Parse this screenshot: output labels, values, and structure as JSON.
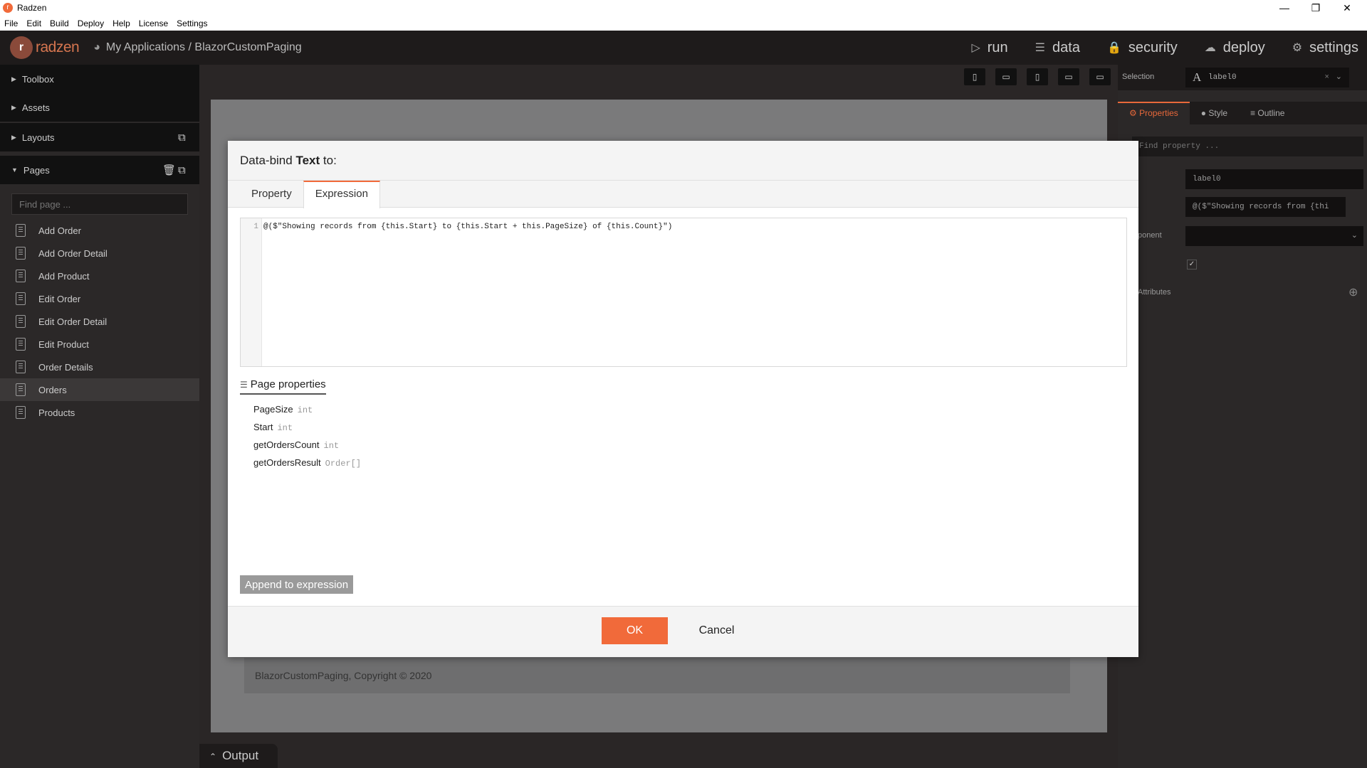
{
  "window": {
    "title": "Radzen",
    "icon": "radzen-app-icon",
    "controls": [
      "minimize",
      "maximize",
      "close"
    ]
  },
  "menu": [
    "File",
    "Edit",
    "Build",
    "Deploy",
    "Help",
    "License",
    "Settings"
  ],
  "header": {
    "logo_text": "radzen",
    "breadcrumb": "My Applications / BlazorCustomPaging",
    "nav": [
      {
        "label": "run",
        "icon": "play-icon"
      },
      {
        "label": "data",
        "icon": "layers-icon"
      },
      {
        "label": "security",
        "icon": "lock-icon"
      },
      {
        "label": "deploy",
        "icon": "cloud-upload-icon"
      },
      {
        "label": "settings",
        "icon": "gear-icon"
      }
    ]
  },
  "sidebar": {
    "sections": [
      "Toolbox",
      "Assets",
      "Layouts",
      "Pages"
    ],
    "find_placeholder": "Find page ...",
    "pages": [
      "Add Order",
      "Add Order Detail",
      "Add Product",
      "Edit Order",
      "Edit Order Detail",
      "Edit Product",
      "Order Details",
      "Orders",
      "Products"
    ],
    "active_page": "Orders"
  },
  "canvas": {
    "footer_text": "BlazorCustomPaging, Copyright © 2020"
  },
  "right_panel": {
    "selection_label": "Selection",
    "selection_value": "label0",
    "tabs": [
      "Properties",
      "Style",
      "Outline"
    ],
    "find_property_placeholder": "Find property ...",
    "field_name": "label0",
    "field_text": "@($\"Showing records from {thi",
    "label_component": "ponent",
    "label_attributes": "Attributes"
  },
  "modal": {
    "title_prefix": "Data-bind",
    "title_bold": "Text",
    "title_suffix": "to:",
    "tabs": [
      "Property",
      "Expression"
    ],
    "active_tab": "Expression",
    "line_number": "1",
    "expression": "@($\"Showing records from {this.Start} to {this.Start + this.PageSize} of {this.Count}\")",
    "page_properties_label": "Page properties",
    "properties": [
      {
        "name": "PageSize",
        "type": "int"
      },
      {
        "name": "Start",
        "type": "int"
      },
      {
        "name": "getOrdersCount",
        "type": "int"
      },
      {
        "name": "getOrdersResult",
        "type": "Order[]"
      }
    ],
    "append_label": "Append to expression",
    "ok_label": "OK",
    "cancel_label": "Cancel"
  },
  "output_label": "Output",
  "colors": {
    "accent": "#f16a3a",
    "dark_bg": "#2b2828",
    "header_bg": "#1e1b1b"
  }
}
